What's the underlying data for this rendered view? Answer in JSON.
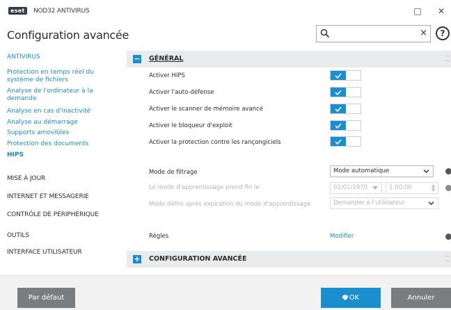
{
  "titlebar": {
    "logo": "eset",
    "title": "NOD32 ANTIVIRUS",
    "minimize": "□",
    "close": "✕"
  },
  "header": {
    "page_title": "Configuration avancée",
    "search_value": "",
    "search_clear": "×",
    "help": "?"
  },
  "sidebar": {
    "sections": [
      {
        "label": "ANTIVIRUS",
        "active": true
      },
      {
        "label": "MISE À JOUR"
      },
      {
        "label": "INTERNET ET MESSAGERIE"
      },
      {
        "label": "CONTRÔLE DE PÉRIPHÉRIQUE"
      },
      {
        "label": "OUTILS"
      },
      {
        "label": "INTERFACE UTILISATEUR"
      }
    ],
    "links": [
      {
        "label": "Protection en temps réel du système de fichiers"
      },
      {
        "label": "Analyse de l'ordinateur à la demande"
      },
      {
        "label": "Analyse en cas d'inactivité"
      },
      {
        "label": "Analyse au démarrage"
      },
      {
        "label": "Supports amovibles"
      },
      {
        "label": "Protection des documents"
      },
      {
        "label": "HIPS",
        "current": true
      }
    ]
  },
  "main": {
    "general": {
      "toggle": "−",
      "title": "GÉNÉRAL",
      "toggles": [
        {
          "label": "Activer HIPS",
          "on": true
        },
        {
          "label": "Activer l'auto-défense",
          "on": true
        },
        {
          "label": "Activer le scanner de mémoire avancé",
          "on": true
        },
        {
          "label": "Activer le bloqueur d'exploit",
          "on": true
        },
        {
          "label": "Activer la protection contre les rançongiciels",
          "on": true
        }
      ],
      "filter_mode_label": "Mode de filtrage",
      "filter_mode_value": "Mode automatique",
      "learning_end_label": "Le mode d'apprentissage prend fin le",
      "learning_end_date": "01/01/1970",
      "learning_end_time": "1:00:00",
      "after_learning_label": "Mode défini après expiration du mode d'apprentissage",
      "after_learning_value": "Demander à l'utilisateur",
      "rules_label": "Règles",
      "rules_link": "Modifier"
    },
    "advanced": {
      "toggle": "+",
      "title": "CONFIGURATION AVANCÉE"
    }
  },
  "footer": {
    "default_label": "Par défaut",
    "ok_label": "OK",
    "cancel_label": "Annuler"
  },
  "colors": {
    "accent": "#1b8ed0",
    "button_gray": "#7a7d80",
    "section_bg": "#e9ebec"
  }
}
